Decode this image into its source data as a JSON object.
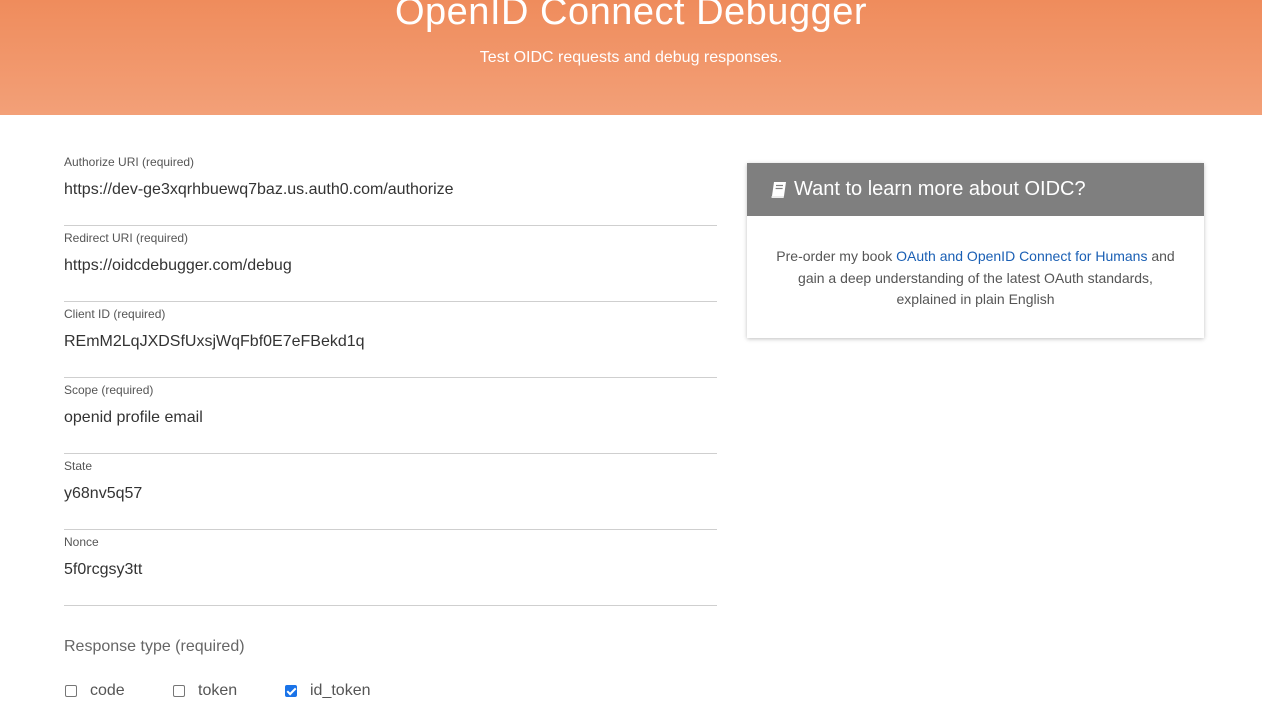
{
  "header": {
    "title": "OpenID Connect Debugger",
    "subtitle": "Test OIDC requests and debug responses."
  },
  "form": {
    "fields": [
      {
        "label": "Authorize URI (required)",
        "value": "https://dev-ge3xqrhbuewq7baz.us.auth0.com/authorize"
      },
      {
        "label": "Redirect URI (required)",
        "value": "https://oidcdebugger.com/debug"
      },
      {
        "label": "Client ID (required)",
        "value": "REmM2LqJXDSfUxsjWqFbf0E7eFBekd1q"
      },
      {
        "label": "Scope (required)",
        "value": "openid profile email"
      },
      {
        "label": "State",
        "value": "y68nv5q57"
      },
      {
        "label": "Nonce",
        "value": "5f0rcgsy3tt"
      }
    ],
    "response_type": {
      "label": "Response type (required)",
      "options": [
        {
          "label": "code",
          "checked": false
        },
        {
          "label": "token",
          "checked": false
        },
        {
          "label": "id_token",
          "checked": true
        }
      ]
    }
  },
  "promo": {
    "icon": "book-icon",
    "title": "Want to learn more about OIDC?",
    "text_before": "Pre-order my book ",
    "link_text": "OAuth and OpenID Connect for Humans",
    "text_after": " and gain a deep understanding of the latest OAuth standards, explained in plain English"
  },
  "colors": {
    "header_gradient_top": "#ef8c5c",
    "header_gradient_bottom": "#f3a078",
    "card_header": "#7f7f7f",
    "link": "#1a5fb4",
    "checkbox_checked": "#1a73e8"
  }
}
